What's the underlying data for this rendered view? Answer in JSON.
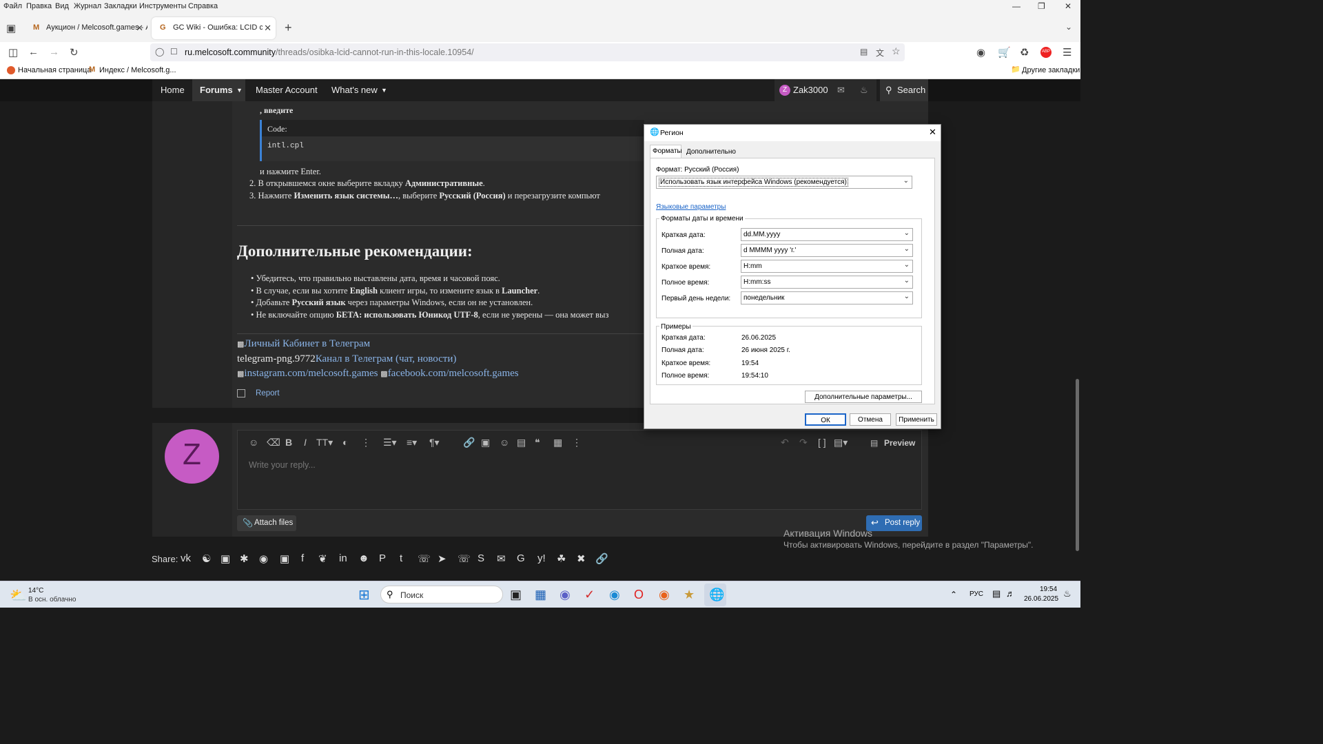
{
  "menubar": {
    "items": [
      "Файл",
      "Правка",
      "Вид",
      "Журнал",
      "Закладки",
      "Инструменты",
      "Справка"
    ]
  },
  "tabs": [
    {
      "title": "Аукцион / Melcosoft.games - А"
    },
    {
      "title": "GC Wiki - Ошибка: LCID cannot"
    }
  ],
  "address": {
    "host": "ru.melcosoft.community",
    "path": "/threads/osibka-lcid-cannot-run-in-this-locale.10954/"
  },
  "bookmarks": {
    "items": [
      "Начальная страница",
      "Индекс / Melcosoft.g..."
    ],
    "other": "Другие закладки"
  },
  "sitenav": {
    "home": "Home",
    "forums": "Forums",
    "master": "Master Account",
    "whatsnew": "What's new",
    "user": "Zak3000",
    "avatar_letter": "Z",
    "search": "Search"
  },
  "post": {
    "enter_line": ", введите",
    "code_label": "Code:",
    "code": "intl.cpl",
    "press_enter": "и нажмите Enter.",
    "step2": {
      "a": "В открывшемся окне выберите вкладку ",
      "b": "Административные",
      "c": "."
    },
    "step3": {
      "a": "Нажмите ",
      "b": "Изменить язык системы…",
      "c": ", выберите ",
      "d": "Русский (Россия)",
      "e": " и перезагрузите компьют"
    },
    "heading": "Дополнительные рекомендации:",
    "bullets": [
      {
        "a": "Убедитесь, что правильно выставлены дата, время и часовой пояс.",
        "b": "",
        "c": "",
        "d": "",
        "e": ""
      },
      {
        "a": "В случае, если вы хотите ",
        "b": "English",
        "c": " клиент игры, то измените язык в ",
        "d": "Launcher",
        "e": "."
      },
      {
        "a": "Добавьте ",
        "b": "Русский язык",
        "c": " через параметры Windows, если он не установлен.",
        "d": "",
        "e": ""
      },
      {
        "a": "Не включайте опцию ",
        "b": "БЕТА: использовать Юникод UTF-8",
        "c": ", если не уверены — она может выз",
        "d": "",
        "e": ""
      }
    ],
    "link1": "Личный Кабинет в Телеграм",
    "tg_prefix": "telegram-png.9772",
    "link2": "Канал в Телеграм (чат, новости)",
    "link3": "instagram.com/melcosoft.games",
    "link4": "facebook.com/melcosoft.games",
    "report": "Report"
  },
  "reply": {
    "avatar_letter": "Z",
    "placeholder": "Write your reply...",
    "preview": "Preview",
    "attach": "Attach files",
    "post": "Post reply"
  },
  "share": {
    "label": "Share:"
  },
  "dialog": {
    "title": "Регион",
    "tabs": [
      "Форматы",
      "Дополнительно"
    ],
    "format_label": "Формат: Русский (Россия)",
    "format_value": "Использовать язык интерфейса Windows (рекомендуется)",
    "lang_link": "Языковые параметры",
    "group_title": "Форматы даты и времени",
    "rows": [
      {
        "label": "Краткая дата:",
        "value": "dd.MM.yyyy"
      },
      {
        "label": "Полная дата:",
        "value": "d MMMM yyyy 'г.'"
      },
      {
        "label": "Краткое время:",
        "value": "H:mm"
      },
      {
        "label": "Полное время:",
        "value": "H:mm:ss"
      },
      {
        "label": "Первый день недели:",
        "value": "понедельник"
      }
    ],
    "examples_title": "Примеры",
    "examples": [
      {
        "label": "Краткая дата:",
        "value": "26.06.2025"
      },
      {
        "label": "Полная дата:",
        "value": "26 июня 2025 г."
      },
      {
        "label": "Краткое время:",
        "value": "19:54"
      },
      {
        "label": "Полное время:",
        "value": "19:54:10"
      }
    ],
    "more_btn": "Дополнительные параметры...",
    "ok": "ОК",
    "cancel": "Отмена",
    "apply": "Применить"
  },
  "watermark": {
    "title": "Активация Windows",
    "subtitle": "Чтобы активировать Windows, перейдите в раздел \"Параметры\"."
  },
  "taskbar": {
    "temp": "14°C",
    "weather": "В осн. облачно",
    "search": "Поиск",
    "lang": "РУС",
    "time": "19:54",
    "date": "26.06.2025"
  }
}
